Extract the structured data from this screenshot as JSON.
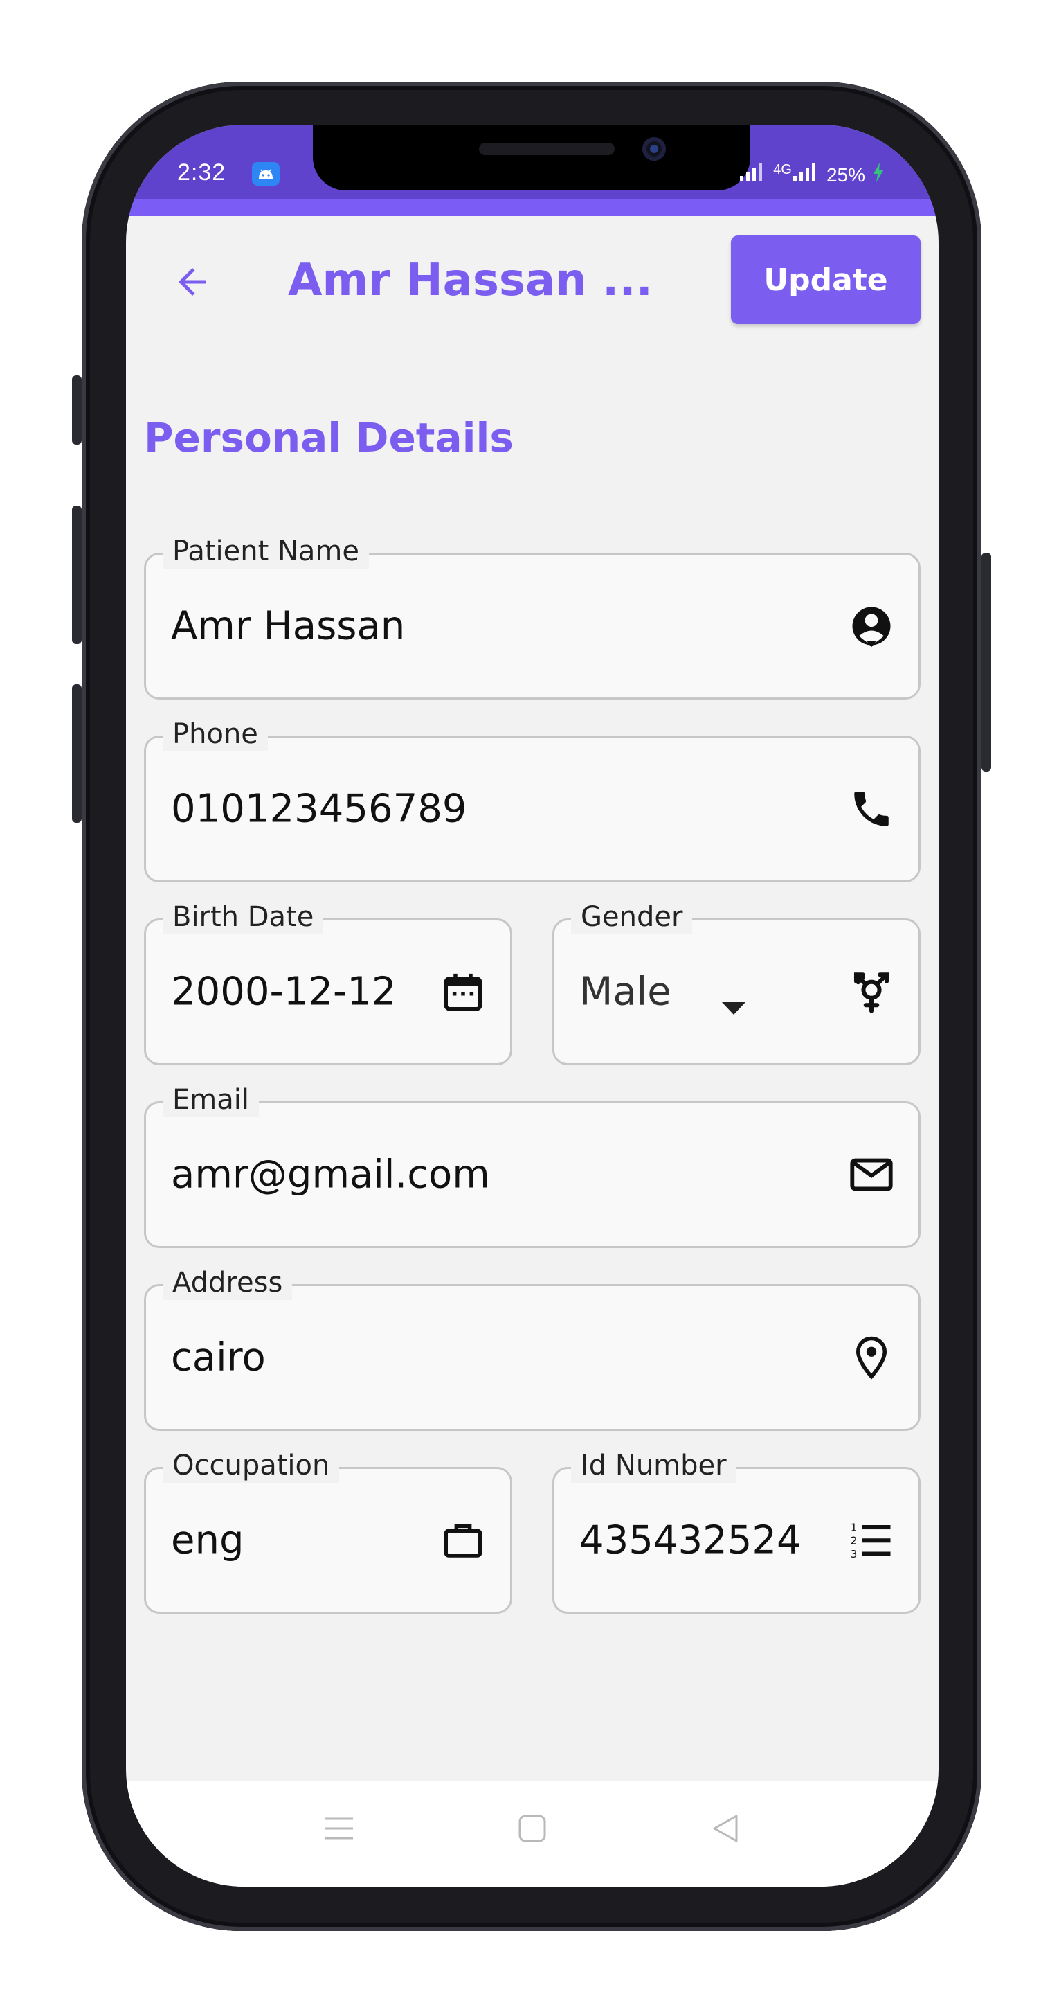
{
  "status_bar": {
    "time": "2:32",
    "network": "4G",
    "battery": "25%"
  },
  "app_bar": {
    "title": "Amr Hassan ...",
    "update_label": "Update",
    "accent_color": "#7b5ef0"
  },
  "section": {
    "title": "Personal Details"
  },
  "fields": {
    "patient_name": {
      "label": "Patient Name",
      "value": "Amr Hassan",
      "icon": "account-circle-icon"
    },
    "phone": {
      "label": "Phone",
      "value": "010123456789",
      "icon": "phone-icon"
    },
    "birth_date": {
      "label": "Birth Date",
      "value": "2000-12-12",
      "icon": "calendar-icon"
    },
    "gender": {
      "label": "Gender",
      "value": "Male",
      "icon": "gender-icon"
    },
    "email": {
      "label": "Email",
      "value": "amr@gmail.com",
      "icon": "mail-icon"
    },
    "address": {
      "label": "Address",
      "value": "cairo",
      "icon": "location-pin-icon"
    },
    "occupation": {
      "label": "Occupation",
      "value": "eng",
      "icon": "briefcase-icon"
    },
    "id_number": {
      "label": "Id Number",
      "value": "435432524",
      "icon": "numbered-list-icon"
    }
  },
  "nav_bar": {
    "buttons": [
      "menu-icon",
      "home-icon",
      "back-icon"
    ]
  }
}
